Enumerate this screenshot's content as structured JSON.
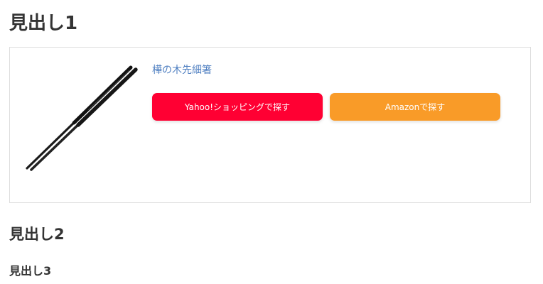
{
  "headings": {
    "h1": "見出し1",
    "h2": "見出し2",
    "h3": "見出し3"
  },
  "product": {
    "title": "樺の木先細箸",
    "image_icon": "chopsticks-image",
    "buttons": {
      "yahoo_label": "Yahoo!ショッピングで探す",
      "amazon_label": "Amazonで探す"
    }
  },
  "colors": {
    "yahoo": "#ff0033",
    "amazon": "#f99b28",
    "link": "#4f7fc1",
    "border": "#dddddd",
    "text": "#333333"
  }
}
